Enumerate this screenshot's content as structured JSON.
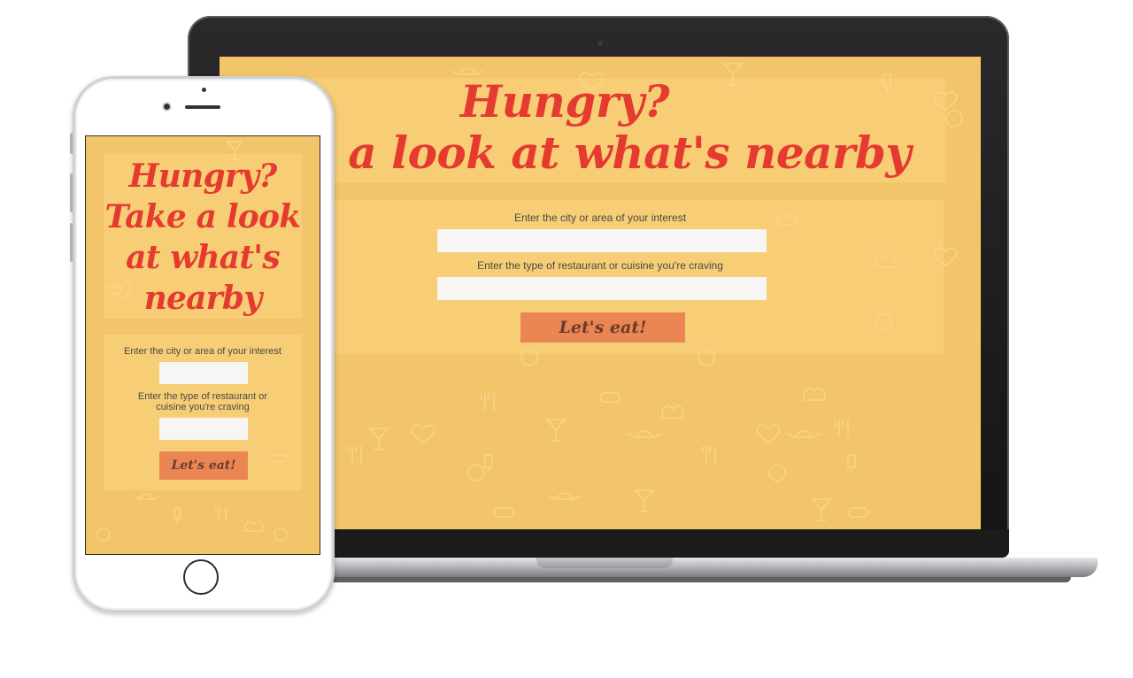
{
  "laptop": {
    "title_line1": "Hungry?",
    "title_line2": "Take a look at what's nearby",
    "city_label": "Enter the city or area of your interest",
    "city_value": "",
    "cuisine_label": "Enter the type of restaurant or cuisine you're craving",
    "cuisine_value": "",
    "submit_label": "Let's eat!"
  },
  "phone": {
    "title_line1": "Hungry?",
    "title_line2": "Take a look",
    "title_line3": "at what's",
    "title_line4": "nearby",
    "city_label": "Enter the city or area of your interest",
    "city_value": "",
    "cuisine_label_line1": "Enter the type of restaurant or",
    "cuisine_label_line2": "cuisine you're craving",
    "cuisine_value": "",
    "submit_label": "Let's eat!"
  },
  "colors": {
    "background_yellow": "#f3c56a",
    "title_red": "#e53a2f",
    "button_orange": "#e98653",
    "input_white": "#f7f6f4"
  },
  "pattern_icons": [
    "cocktail-glass-icon",
    "heart-icon",
    "teapot-icon",
    "fork-knife-icon",
    "smiley-icon",
    "chef-hat-icon",
    "hotdog-icon",
    "popsicle-icon"
  ]
}
